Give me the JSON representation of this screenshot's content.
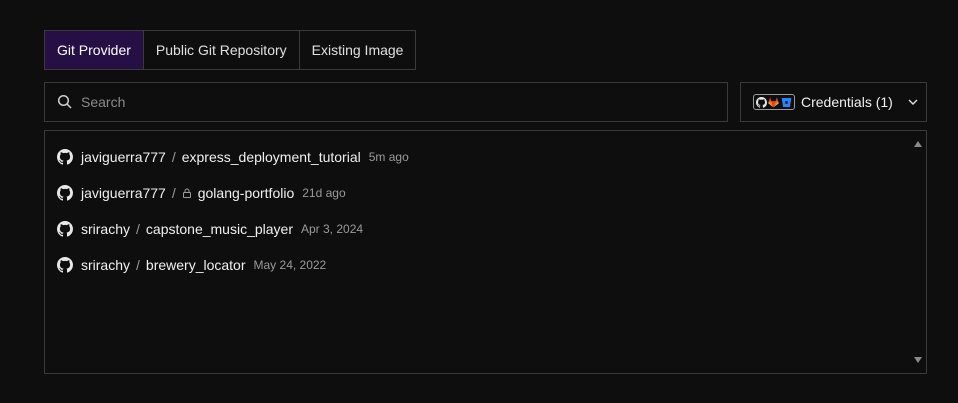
{
  "tabs": [
    {
      "label": "Git Provider",
      "active": true
    },
    {
      "label": "Public Git Repository",
      "active": false
    },
    {
      "label": "Existing Image",
      "active": false
    }
  ],
  "search": {
    "placeholder": "Search",
    "value": "",
    "icon": "search-icon"
  },
  "credentials": {
    "label": "Credentials (1)",
    "logos": [
      "github-icon",
      "gitlab-icon",
      "bitbucket-icon"
    ],
    "dropdown_icon": "chevron-down-icon"
  },
  "repositories": [
    {
      "owner": "javiguerra777",
      "separator": "/",
      "name": "express_deployment_tutorial",
      "updated": "5m ago",
      "private": false
    },
    {
      "owner": "javiguerra777",
      "separator": "/",
      "name": "golang-portfolio",
      "updated": "21d ago",
      "private": true
    },
    {
      "owner": "srirachy",
      "separator": "/",
      "name": "capstone_music_player",
      "updated": "Apr 3, 2024",
      "private": false
    },
    {
      "owner": "srirachy",
      "separator": "/",
      "name": "brewery_locator",
      "updated": "May 24, 2022",
      "private": false
    }
  ],
  "colors": {
    "background": "#0e0e0e",
    "border": "#3a3a3a",
    "active_tab": "#260f45",
    "muted_text": "#9a9a9a"
  }
}
